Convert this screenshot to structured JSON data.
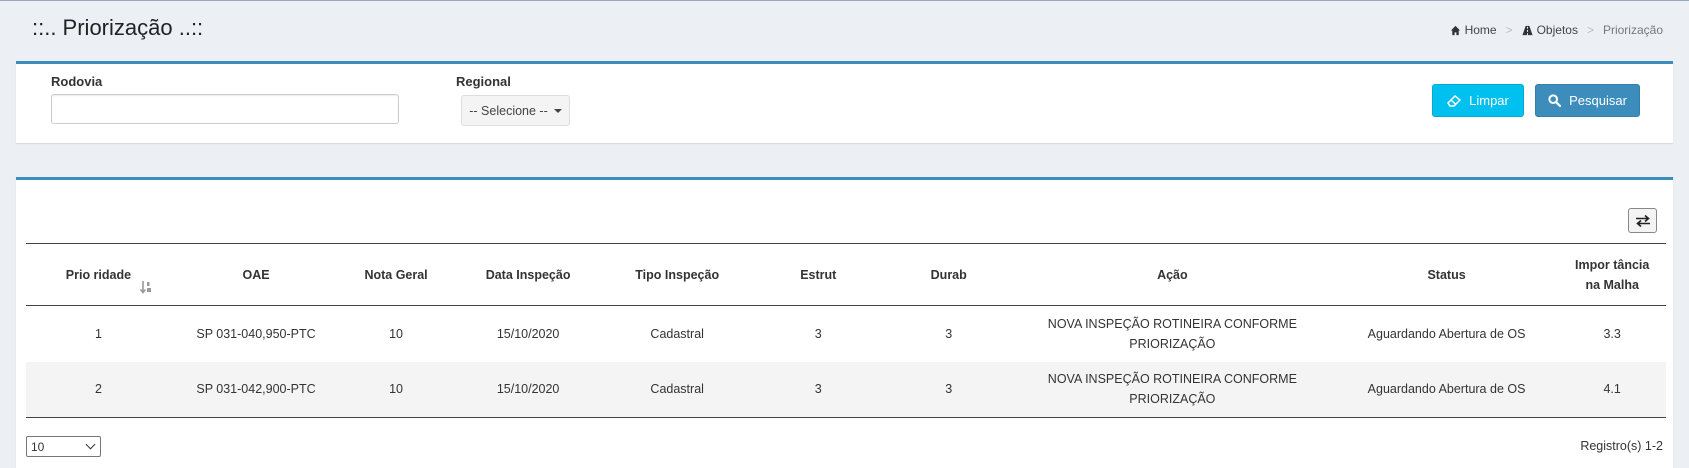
{
  "header": {
    "title": "::.. Priorização ..::",
    "breadcrumb": [
      {
        "label": "Home",
        "icon": "home-icon"
      },
      {
        "label": "Objetos",
        "icon": "road-icon"
      },
      {
        "label": "Priorização"
      }
    ]
  },
  "filters": {
    "rodovia_label": "Rodovia",
    "rodovia_value": "",
    "regional_label": "Regional",
    "regional_selected": "-- Selecione --",
    "limpar_label": "Limpar",
    "pesquisar_label": "Pesquisar",
    "colors": {
      "limpar": "#00c0ef",
      "pesquisar": "#3c8dbc",
      "box_border": "#3c8dbc"
    }
  },
  "table": {
    "columns": [
      "Prio ridade",
      "OAE",
      "Nota Geral",
      "Data Inspeção",
      "Tipo Inspeção",
      "Estrut",
      "Durab",
      "Ação",
      "Status",
      "Impor tância na Malha"
    ],
    "rows": [
      {
        "prioridade": "1",
        "oae": "SP 031-040,950-PTC",
        "nota_geral": "10",
        "data_inspecao": "15/10/2020",
        "tipo_inspecao": "Cadastral",
        "estrut": "3",
        "durab": "3",
        "acao_line1": "NOVA INSPEÇÃO ROTINEIRA CONFORME",
        "acao_line2": "PRIORIZAÇÃO",
        "status": "Aguardando Abertura de OS",
        "importancia": "3.3"
      },
      {
        "prioridade": "2",
        "oae": "SP 031-042,900-PTC",
        "nota_geral": "10",
        "data_inspecao": "15/10/2020",
        "tipo_inspecao": "Cadastral",
        "estrut": "3",
        "durab": "3",
        "acao_line1": "NOVA INSPEÇÃO ROTINEIRA CONFORME",
        "acao_line2": "PRIORIZAÇÃO",
        "status": "Aguardando Abertura de OS",
        "importancia": "4.1"
      }
    ]
  },
  "footer": {
    "page_size": "10",
    "records": "Registro(s) 1-2"
  }
}
